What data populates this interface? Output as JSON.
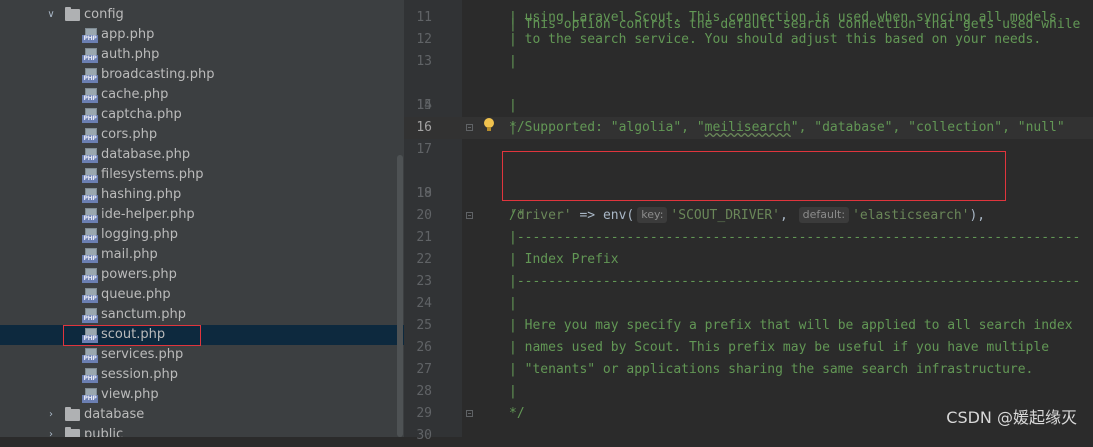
{
  "tree": {
    "folders": {
      "config": "config",
      "database": "database",
      "public": "public"
    },
    "config_files": [
      "app.php",
      "auth.php",
      "broadcasting.php",
      "cache.php",
      "captcha.php",
      "cors.php",
      "database.php",
      "filesystems.php",
      "hashing.php",
      "ide-helper.php",
      "logging.php",
      "mail.php",
      "powers.php",
      "queue.php",
      "sanctum.php",
      "scout.php",
      "services.php",
      "session.php",
      "view.php"
    ],
    "selected_file": "scout.php",
    "file_icon_badge": "PHP"
  },
  "editor": {
    "lines": [
      {
        "num": "11",
        "text": "| using Laravel Scout. This connection is used when syncing all models"
      },
      {
        "num": "12",
        "text": "| to the search service. You should adjust this based on your needs."
      },
      {
        "num": "13",
        "text": "|"
      },
      {
        "num": "14",
        "text": ""
      },
      {
        "num": "15",
        "text": "|"
      },
      {
        "num": "16",
        "text": "*/"
      },
      {
        "num": "17",
        "text": ""
      },
      {
        "num": "18",
        "text": ""
      },
      {
        "num": "19",
        "text": ""
      },
      {
        "num": "20",
        "text": "/*"
      },
      {
        "num": "21",
        "text": "|------------------------------------------------------------------------"
      },
      {
        "num": "22",
        "text": "| Index Prefix"
      },
      {
        "num": "23",
        "text": "|------------------------------------------------------------------------"
      },
      {
        "num": "24",
        "text": "|"
      },
      {
        "num": "25",
        "text": "| Here you may specify a prefix that will be applied to all search index"
      },
      {
        "num": "26",
        "text": "| names used by Scout. This prefix may be useful if you have multiple"
      },
      {
        "num": "27",
        "text": "| \"tenants\" or applications sharing the same search infrastructure."
      },
      {
        "num": "28",
        "text": "|"
      },
      {
        "num": "29",
        "text": "*/"
      },
      {
        "num": "30",
        "text": ""
      }
    ],
    "top_partial": "| This option controls the default search connection that gets used while",
    "supported_line": {
      "prefix": "| Supported: \"algolia\", \"",
      "warn_word": "meilisearch",
      "suffix": "\", \"database\", \"collection\", \"null\""
    },
    "driver_line": {
      "key": "'driver'",
      "arrow": " => ",
      "func": "env(",
      "hint_key": "key:",
      "arg1": "'SCOUT_DRIVER'",
      "comma": ",",
      "hint_default": "default:",
      "arg2": "'elasticsearch'",
      "close": "),"
    },
    "current_line": "16"
  },
  "watermark": "CSDN @媛起缘灭"
}
